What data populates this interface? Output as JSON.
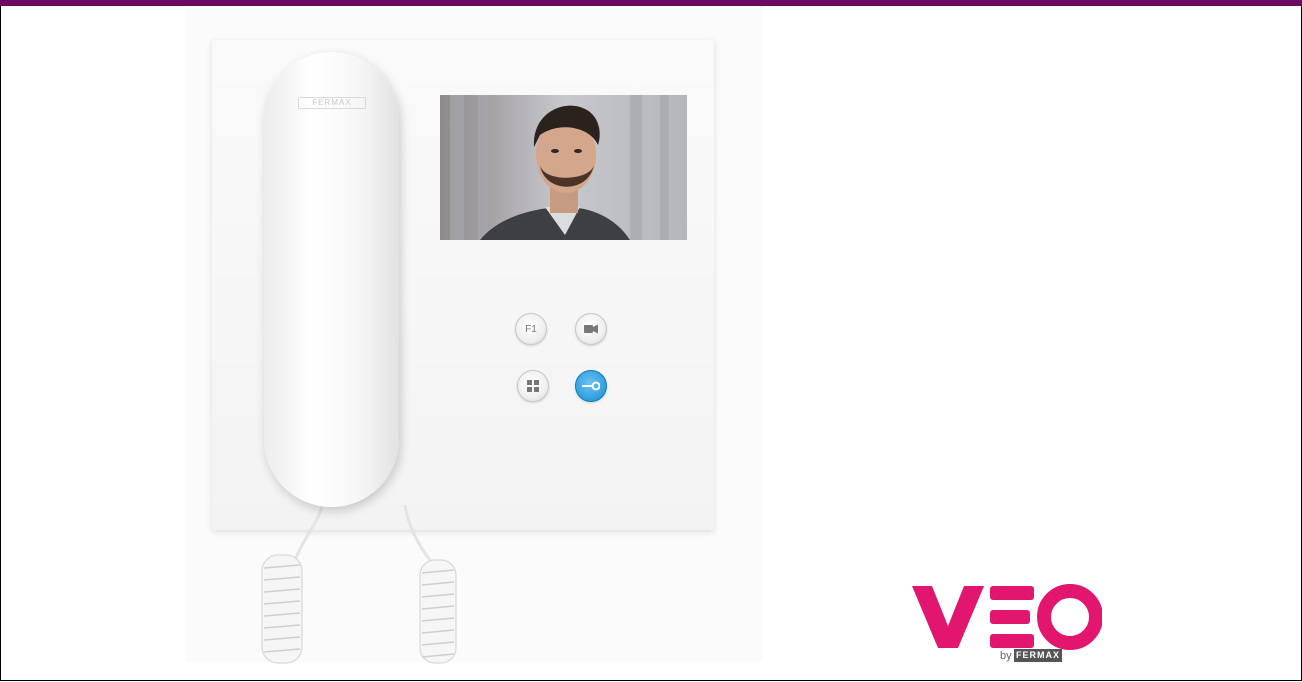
{
  "page": {
    "accent_bar_color": "#6b0a5e"
  },
  "device": {
    "handset_brand": "FERMAX",
    "buttons": [
      {
        "label": "F1",
        "icon": "f1-icon"
      },
      {
        "label": "",
        "icon": "camera-icon"
      },
      {
        "label": "",
        "icon": "grid-icon"
      },
      {
        "label": "",
        "icon": "key-icon"
      }
    ],
    "key_button_color": "#2d9ee0"
  },
  "logo": {
    "wordmark": "VEO",
    "by": "by",
    "brand": "FERMAX",
    "color": "#e2166f"
  }
}
